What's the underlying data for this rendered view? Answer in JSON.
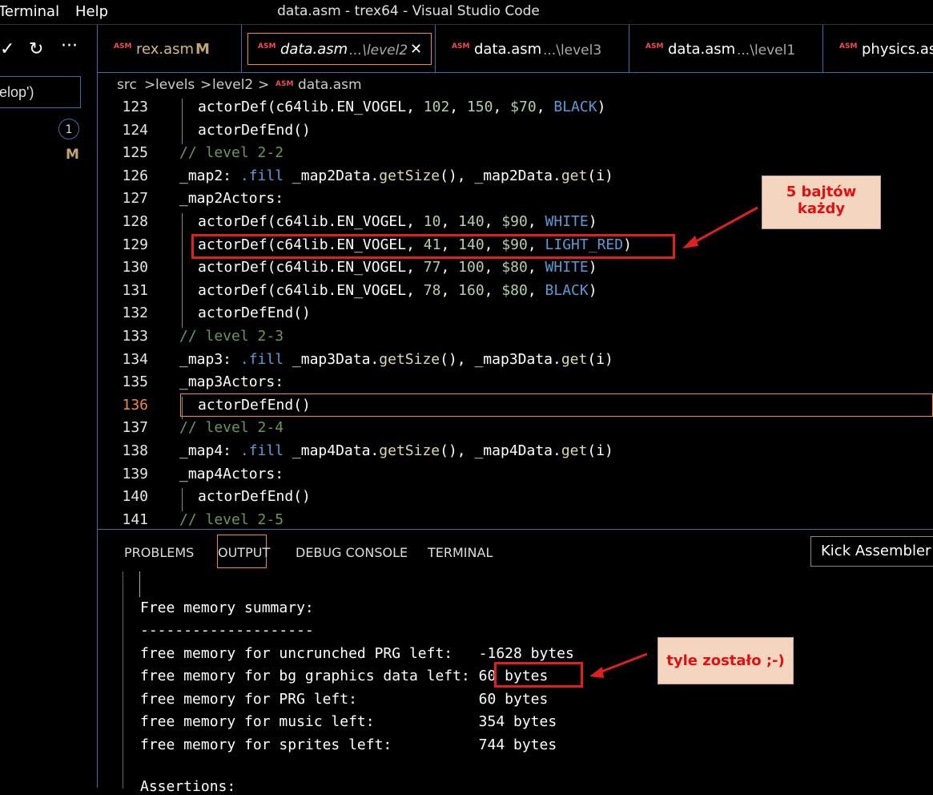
{
  "menu": {
    "terminal": "Terminal",
    "help": "Help"
  },
  "window_title": "data.asm - trex64 - Visual Studio Code",
  "sidebar": {
    "check_icon": "✓",
    "refresh_icon": "↻",
    "more_icon": "···",
    "input_value": "elop')",
    "badge": "1",
    "modified": "M"
  },
  "tabs": [
    {
      "icon": "ASM",
      "name": "rex.asm",
      "extra": "M",
      "path": ""
    },
    {
      "icon": "ASM",
      "name": "data.asm",
      "path": "...\\level2",
      "close": "✕"
    },
    {
      "icon": "ASM",
      "name": "data.asm",
      "path": "...\\level3"
    },
    {
      "icon": "ASM",
      "name": "data.asm",
      "path": "...\\level1"
    },
    {
      "icon": "ASM",
      "name": "physics.asm",
      "path": ""
    }
  ],
  "breadcrumb": {
    "p1": "src",
    "p2": "levels",
    "p3": "level2",
    "icon": "ASM",
    "file": "data.asm",
    "sep": ">"
  },
  "lines": [
    {
      "n": "123",
      "segs": [
        [
          "fn",
          "actorDef(c64lib.EN_VOGEL, "
        ],
        [
          "num",
          "102"
        ],
        [
          "fn",
          ", "
        ],
        [
          "num",
          "150"
        ],
        [
          "fn",
          ", "
        ],
        [
          "num",
          "$70"
        ],
        [
          "fn",
          ", "
        ],
        [
          "const",
          "BLACK"
        ],
        [
          "fn",
          ")"
        ]
      ]
    },
    {
      "n": "124",
      "segs": [
        [
          "fn",
          "actorDefEnd()"
        ]
      ]
    },
    {
      "n": "125",
      "segs": [
        [
          "cmt",
          "// level 2-2"
        ]
      ]
    },
    {
      "n": "126",
      "segs": [
        [
          "lbl",
          "_map2: "
        ],
        [
          "dir",
          ".fill "
        ],
        [
          "lbl",
          "_map2Data."
        ],
        [
          "meth",
          "getSize"
        ],
        [
          "lbl",
          "(), _map2Data."
        ],
        [
          "meth",
          "get"
        ],
        [
          "lbl",
          "(i)"
        ]
      ]
    },
    {
      "n": "127",
      "segs": [
        [
          "lbl",
          "_map2Actors:"
        ]
      ]
    },
    {
      "n": "128",
      "segs": [
        [
          "fn",
          "actorDef(c64lib.EN_VOGEL, "
        ],
        [
          "num",
          "10"
        ],
        [
          "fn",
          ", "
        ],
        [
          "num",
          "140"
        ],
        [
          "fn",
          ", "
        ],
        [
          "num",
          "$90"
        ],
        [
          "fn",
          ", "
        ],
        [
          "const",
          "WHITE"
        ],
        [
          "fn",
          ")"
        ]
      ]
    },
    {
      "n": "129",
      "segs": [
        [
          "fn",
          "actorDef(c64lib.EN_VOGEL, "
        ],
        [
          "num",
          "41"
        ],
        [
          "fn",
          ", "
        ],
        [
          "num",
          "140"
        ],
        [
          "fn",
          ", "
        ],
        [
          "num",
          "$90"
        ],
        [
          "fn",
          ", "
        ],
        [
          "const",
          "LIGHT_RED"
        ],
        [
          "fn",
          ")"
        ]
      ]
    },
    {
      "n": "130",
      "segs": [
        [
          "fn",
          "actorDef(c64lib.EN_VOGEL, "
        ],
        [
          "num",
          "77"
        ],
        [
          "fn",
          ", "
        ],
        [
          "num",
          "100"
        ],
        [
          "fn",
          ", "
        ],
        [
          "num",
          "$80"
        ],
        [
          "fn",
          ", "
        ],
        [
          "const",
          "WHITE"
        ],
        [
          "fn",
          ")"
        ]
      ]
    },
    {
      "n": "131",
      "segs": [
        [
          "fn",
          "actorDef(c64lib.EN_VOGEL, "
        ],
        [
          "num",
          "78"
        ],
        [
          "fn",
          ", "
        ],
        [
          "num",
          "160"
        ],
        [
          "fn",
          ", "
        ],
        [
          "num",
          "$80"
        ],
        [
          "fn",
          ", "
        ],
        [
          "const",
          "BLACK"
        ],
        [
          "fn",
          ")"
        ]
      ]
    },
    {
      "n": "132",
      "segs": [
        [
          "fn",
          "actorDefEnd()"
        ]
      ]
    },
    {
      "n": "133",
      "segs": [
        [
          "cmt",
          "// level 2-3"
        ]
      ]
    },
    {
      "n": "134",
      "segs": [
        [
          "lbl",
          "_map3: "
        ],
        [
          "dir",
          ".fill "
        ],
        [
          "lbl",
          "_map3Data."
        ],
        [
          "meth",
          "getSize"
        ],
        [
          "lbl",
          "(), _map3Data."
        ],
        [
          "meth",
          "get"
        ],
        [
          "lbl",
          "(i)"
        ]
      ]
    },
    {
      "n": "135",
      "segs": [
        [
          "lbl",
          "_map3Actors:"
        ]
      ]
    },
    {
      "n": "136",
      "segs": [
        [
          "fn",
          "actorDefEnd()"
        ]
      ]
    },
    {
      "n": "137",
      "segs": [
        [
          "cmt",
          "// level 2-4"
        ]
      ]
    },
    {
      "n": "138",
      "segs": [
        [
          "lbl",
          "_map4: "
        ],
        [
          "dir",
          ".fill "
        ],
        [
          "lbl",
          "_map4Data."
        ],
        [
          "meth",
          "getSize"
        ],
        [
          "lbl",
          "(), _map4Data."
        ],
        [
          "meth",
          "get"
        ],
        [
          "lbl",
          "(i)"
        ]
      ]
    },
    {
      "n": "139",
      "segs": [
        [
          "lbl",
          "_map4Actors:"
        ]
      ]
    },
    {
      "n": "140",
      "segs": [
        [
          "fn",
          "actorDefEnd()"
        ]
      ]
    },
    {
      "n": "141",
      "segs": [
        [
          "cmt",
          "// level 2-5"
        ]
      ]
    }
  ],
  "annotation_top": {
    "line1": "5 bajtów",
    "line2": "każdy"
  },
  "annotation_bottom": {
    "text": "tyle zostało ;-)"
  },
  "panel": {
    "tabs": [
      "PROBLEMS",
      "OUTPUT",
      "DEBUG CONSOLE",
      "TERMINAL"
    ],
    "dropdown": "Kick Assembler",
    "output": [
      "Free memory summary:",
      "--------------------",
      "free memory for uncrunched PRG left:   -1628 bytes",
      "free memory for bg graphics data left: 60 bytes",
      "free memory for PRG left:              60 bytes",
      "free memory for music left:            354 bytes",
      "free memory for sprites left:          744 bytes",
      "",
      "Assertions:"
    ]
  },
  "colors": {
    "accent": "#3a6ea5",
    "active_border": "#f0883e",
    "highlight": "#e02020",
    "note_bg": "#f4d5c0"
  }
}
